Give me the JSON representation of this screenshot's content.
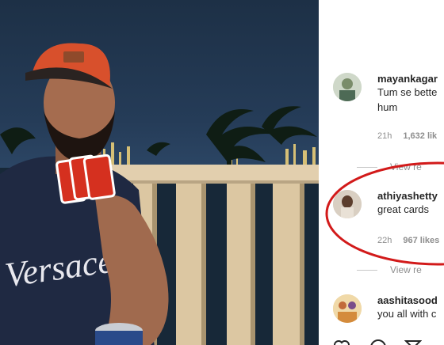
{
  "comments": [
    {
      "username": "mayankagar",
      "text_lines": [
        "Tum se bette",
        "hum"
      ],
      "time": "21h",
      "likes": "1,632 lik"
    },
    {
      "username": "athiyashetty",
      "text_lines": [
        "great cards"
      ],
      "time": "22h",
      "likes": "967 likes"
    },
    {
      "username": "aashitasood",
      "text_lines": [
        "you all with c"
      ]
    }
  ],
  "view_replies_label": "View re",
  "view_replies_label_2": "View re",
  "highlight_color": "#d21a1a",
  "icons": [
    "heart-icon",
    "comment-icon",
    "share-icon"
  ]
}
